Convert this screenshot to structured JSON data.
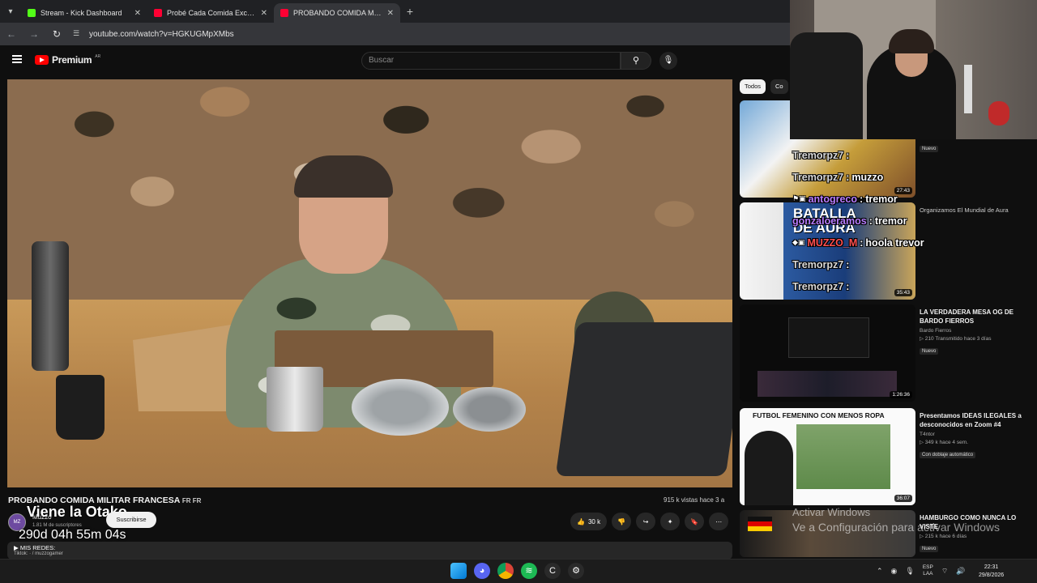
{
  "browser": {
    "tabs": [
      {
        "title": "Stream - Kick Dashboard",
        "color": "#53fc18",
        "active": false
      },
      {
        "title": "Probé Cada Comida Exclusiva d",
        "color": "#ff0033",
        "active": false
      },
      {
        "title": "PROBANDO COMIDA MILITAR",
        "color": "#ff0033",
        "active": true
      }
    ],
    "url": "youtube.com/watch?v=HGKUGMpXMbs"
  },
  "youtube": {
    "brand": "Premium",
    "region": "AR",
    "search_placeholder": "Buscar"
  },
  "video": {
    "title": "PROBANDO COMIDA MILITAR FRANCESA",
    "title_flag": "FR FR",
    "views": "915 k vistas  hace 3 a",
    "channel": "Muzzo",
    "subscribers": "1.81 M de suscriptores",
    "subscribe_label": "Suscribirse",
    "likes": "30 k",
    "overlay_line1": "Viene la Otako",
    "overlay_line2": "290d 04h 55m 04s",
    "description_line1": "▶ MIS REDES:",
    "description_line2": "Tiktok: · / muzzogamer"
  },
  "sidebar": {
    "chips": [
      "Todos",
      "Co"
    ],
    "recs": [
      {
        "title": "",
        "channel": "",
        "stats": "",
        "badge": "Nuevo",
        "duration": "27:43"
      },
      {
        "title": "Organizamos El Mundial de Aura",
        "channel": "",
        "stats": "",
        "badge": "",
        "duration": "35:43"
      },
      {
        "title": "LA VERDADERA MESA OG DE BARDO FIERROS",
        "channel": "Bardo Fierros",
        "stats": "▷ 210  Transmitido hace 3 días",
        "badge": "Nuevo",
        "duration": "1:26:36"
      },
      {
        "title": "Presentamos IDEAS ILEGALES a desconocidos en Zoom #4",
        "channel": "T4ntor",
        "stats": "▷ 349 k  hace 4 sem.",
        "badge": "Con doblaje automático",
        "duration": "36:07"
      },
      {
        "title": "HAMBURGO COMO NUNCA LO VISTE",
        "channel": "",
        "stats": "▷ 215 k  hace 6 días",
        "badge": "Nuevo",
        "duration": ""
      }
    ],
    "thumb_texts": {
      "rec2_top": "BATALLA",
      "rec2_bottom": "DE AURA",
      "rec4": "FUTBOL FEMENINO CON MENOS ROPA"
    }
  },
  "chat": [
    {
      "user": "Tremorpz7",
      "msg": ""
    },
    {
      "user": "Tremorpz7",
      "msg": "muzzo"
    },
    {
      "user": "antogreco",
      "msg": "tremor"
    },
    {
      "user": "gonzaloeramos",
      "msg": "tremor"
    },
    {
      "user": "MUZZO_M",
      "msg": "hoola trevor"
    },
    {
      "user": "Tremorpz7",
      "msg": ""
    },
    {
      "user": "Tremorpz7",
      "msg": ""
    }
  ],
  "watermark": {
    "line1": "Activar Windows",
    "line2": "Ve a Configuración para activar Windows"
  },
  "taskbar": {
    "lang": "ESP",
    "lang2": "LAA",
    "time": "22:31",
    "date": "29/8/2026"
  }
}
